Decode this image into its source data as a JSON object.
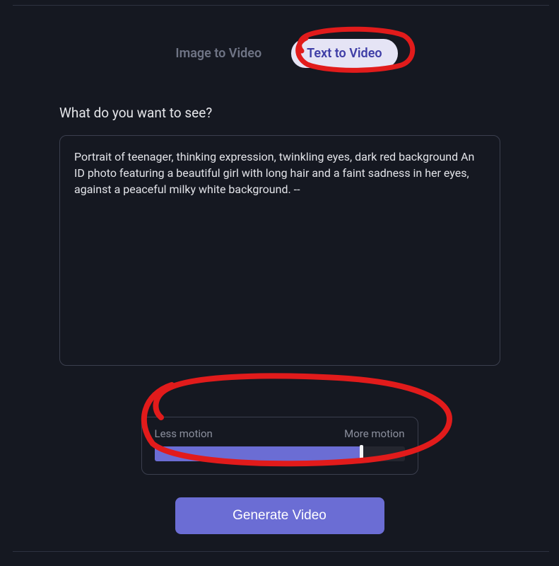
{
  "tabs": {
    "image_to_video": "Image to Video",
    "text_to_video": "Text to Video"
  },
  "prompt": {
    "label": "What do you want to see?",
    "value": "Portrait of teenager, thinking expression, twinkling eyes, dark red background An ID photo featuring a beautiful girl with long hair and a faint sadness in her eyes, against a peaceful milky white background. --"
  },
  "motion": {
    "less_label": "Less motion",
    "more_label": "More motion",
    "value": 82.5
  },
  "generate_button": "Generate Video"
}
